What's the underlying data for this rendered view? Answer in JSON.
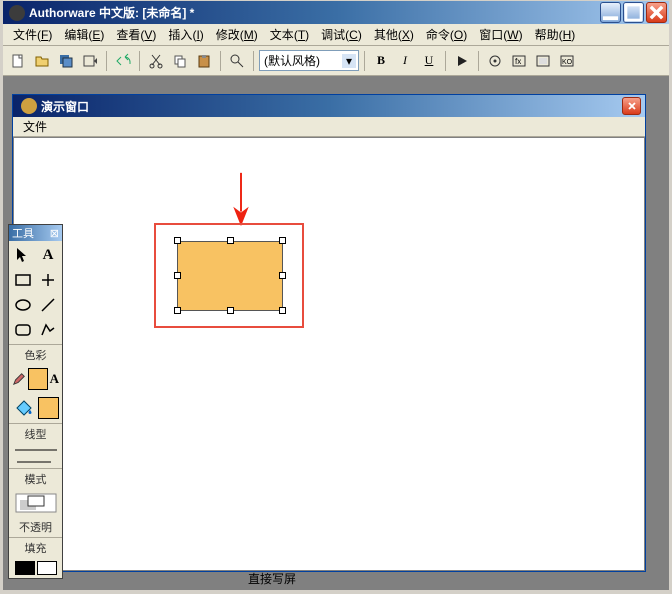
{
  "window": {
    "title": "Authorware 中文版: [未命名] *"
  },
  "menu": {
    "file": {
      "label": "文件",
      "key": "F"
    },
    "edit": {
      "label": "编辑",
      "key": "E"
    },
    "view": {
      "label": "查看",
      "key": "V"
    },
    "insert": {
      "label": "插入",
      "key": "I"
    },
    "modify": {
      "label": "修改",
      "key": "M"
    },
    "text": {
      "label": "文本",
      "key": "T"
    },
    "debug": {
      "label": "调试",
      "key": "C"
    },
    "other": {
      "label": "其他",
      "key": "X"
    },
    "command": {
      "label": "命令",
      "key": "O"
    },
    "window": {
      "label": "窗口",
      "key": "W"
    },
    "help": {
      "label": "帮助",
      "key": "H"
    }
  },
  "toolbar": {
    "style_dropdown": "(默认风格)"
  },
  "pres_window": {
    "title": "演示窗口",
    "menu_file": "文件"
  },
  "toolbox": {
    "title": "工具",
    "section_color": "色彩",
    "section_line": "线型",
    "section_mode": "模式",
    "opaque": "不透明",
    "section_fill": "填充"
  },
  "bottom_label": "直接写屏"
}
